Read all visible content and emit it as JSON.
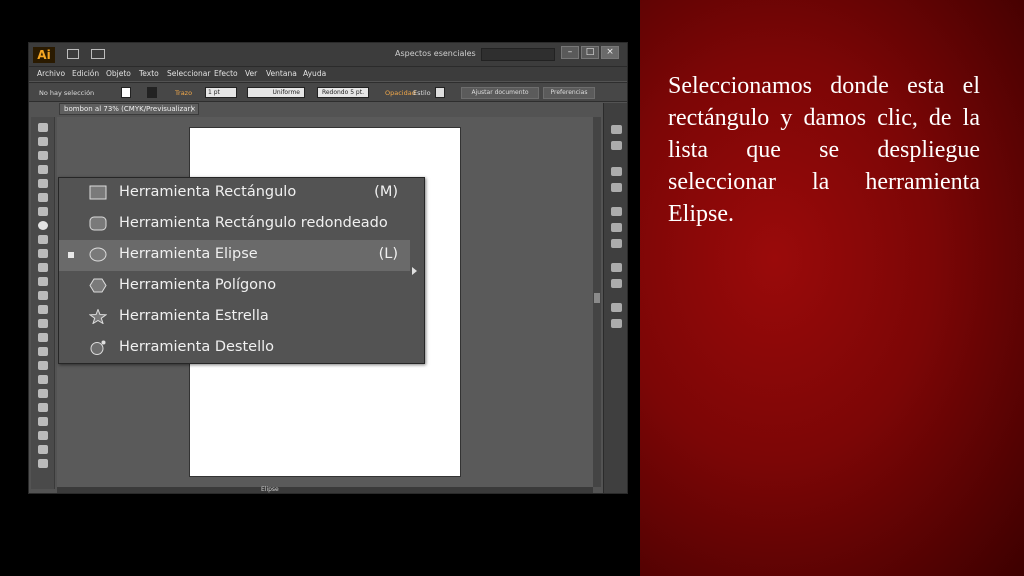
{
  "slide_text": "Seleccionamos donde esta el rectángulo y damos clic, de la lista que se despliegue seleccionar la herramienta Elipse.",
  "app": {
    "logo": "Ai",
    "workspace": "Aspectos esenciales",
    "menu": [
      "Archivo",
      "Edición",
      "Objeto",
      "Texto",
      "Seleccionar",
      "Efecto",
      "Ver",
      "Ventana",
      "Ayuda"
    ],
    "control": {
      "selection": "No hay selección",
      "stroke_label": "Trazo",
      "stroke_value": "1 pt",
      "profile": "Uniforme",
      "brush": "Redondo 5 pt.",
      "opacity_label": "Opacidad",
      "style_label": "Estilo",
      "adjust_button": "Ajustar documento",
      "prefs_button": "Preferencias"
    },
    "doc_tab": "bombon al 73% (CMYK/Previsualizar)",
    "doc_tab_close": "×",
    "status_tool": "Elipse"
  },
  "flyout": {
    "items": [
      {
        "label": "Herramienta Rectángulo",
        "shortcut": "(M)",
        "icon": "rectangle-icon"
      },
      {
        "label": "Herramienta Rectángulo redondeado",
        "shortcut": "",
        "icon": "rounded-rectangle-icon"
      },
      {
        "label": "Herramienta Elipse",
        "shortcut": "(L)",
        "icon": "ellipse-icon",
        "selected": true
      },
      {
        "label": "Herramienta Polígono",
        "shortcut": "",
        "icon": "polygon-icon"
      },
      {
        "label": "Herramienta Estrella",
        "shortcut": "",
        "icon": "star-icon"
      },
      {
        "label": "Herramienta Destello",
        "shortcut": "",
        "icon": "flare-icon"
      }
    ]
  },
  "colors": {
    "slide_red": "#7c0606",
    "ai_ui": "#535353",
    "menu_selected": "#6a6a6a",
    "text": "#f0f0f0"
  }
}
